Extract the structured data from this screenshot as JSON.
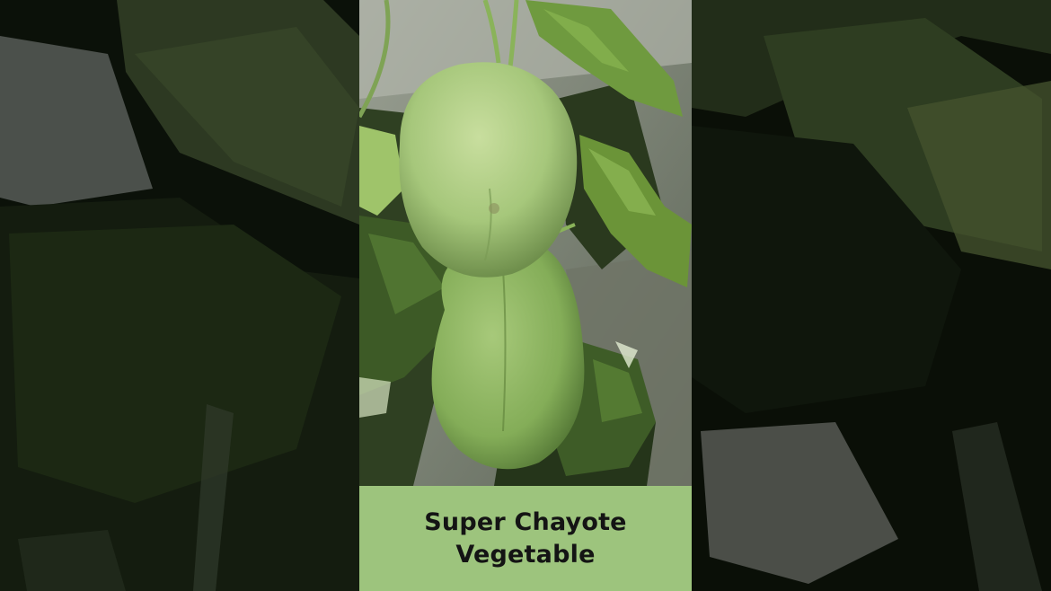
{
  "caption": {
    "line1": "Super Chayote",
    "line2": "Vegetable",
    "band_color": "#9dc47d"
  },
  "photo": {
    "subject": "chayote-fruits-on-vine",
    "fruit_count": 2
  }
}
